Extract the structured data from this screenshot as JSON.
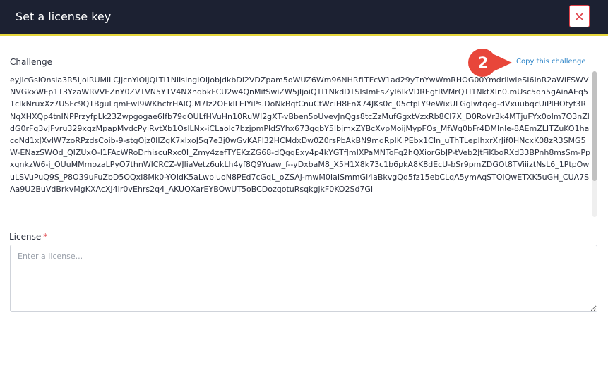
{
  "dialog": {
    "title": "Set a license key",
    "close_icon": "close-icon",
    "accent_color": "#e6d63c",
    "header_color": "#1c2132",
    "close_color": "#e0434a"
  },
  "challenge": {
    "label": "Challenge",
    "copy_label": "Copy this challenge",
    "step_number": "2",
    "step_color": "#e8463a",
    "text": "eyJlcGsiOnsia3R5IjoiRUMiLCJjcnYiOiJQLTI1NiIsIngiOiJobjdkbDl2VDZpam5oWUZ6Wm96NHRfLTFcW1ad29yTnYwWmRHOG00YmdrliwieSI6InR2aWlFSWVNVGkxWFp1T3YzaWRVVEZnY0ZVTVN5Y1V4NXhqbkFCU2w4QnMifSwiZW5jIjoiQTI1NkdDTSIsImFsZyI6IkVDREgtRVMrQTI1NktXIn0.mUsc5qn5gAinAEq51cIkNruxXz7USFc9QTBguLqmEwI9WKhcfrHAlQ.M7Iz2OEkILEIYiPs.DoNkBqfCnuCtWciH8FnX74JKs0c_05cfpLY9eWixULGgIwtqeg-dVxuubqcUiPlHOtyf3RNqXHXQp4tnINPPrzyfpLk23Zwpgogae6Ifb79qOULfHVuHn10RuWI2gXT-vBben5oUvevJnQgs8tcZzMufGgxtVzxRb8Cl7X_D0RoVr3k4MTjuFYx0oIm7O3nZldG0rFg3vJFvru329xqzMpapMvdcPyiRvtXb1OslLNx-iCLaolc7bzjpmPldSYhx673gqbY5IbjmxZYBcXvpMoijMypFOs_MfWg0bFr4DMInle-8AEmZLITZuKO1hacoNd1xJXvIW7zoRPzdsCoib-9-stgOjz0IIZgK7xlxoJ5q7e3j0wGvKAFl32HCMdxDw0Z0rsPbAkBN9mdRpIKlPEbx1CIn_uThTLeplhxrXrJif0HNcxK08zR3SMG5W-ENazSWOd_QlZUxO-l1FAcWRoDrhiscuRxc0I_Zmy4zefTYEKzZG68-dQgqExy4p4kYGTfJmIXPaMNToFq2hQXiorGbJP-tVeb2JtFiKboRXd33BPnh8msSm-PpxgnkzW6-j_OUuMMmozaLPyO7thnWlCRCZ-VJliaVetz6ukLh4yf8Q9Yuaw_f--yDxbaM8_X5H1X8k73c1b6pkA8K8dEcU-bSr9pmZDGOt8TViiiztNsL6_1PtpOwuLSVuPuQ9S_P8O39uFuZbD5OQxI8Mk0-YOIdK5aLwpiuoN8PEd7cGqL_oZSAj-mwM0IaISmmGi4aBkvgQq5fz15ebCLqA5ymAqSTOiQwETXK5uGH_CUA7SAa9U2BuVdBrkvMgKXAcXJ4Ir0vEhrs2q4_AKUQXarEYBOwUT5oBCDozqotuRsqkgjkF0KO2Sd7Gi"
  },
  "license": {
    "label": "License",
    "required_mark": "*",
    "placeholder": "Enter a license...",
    "value": ""
  }
}
